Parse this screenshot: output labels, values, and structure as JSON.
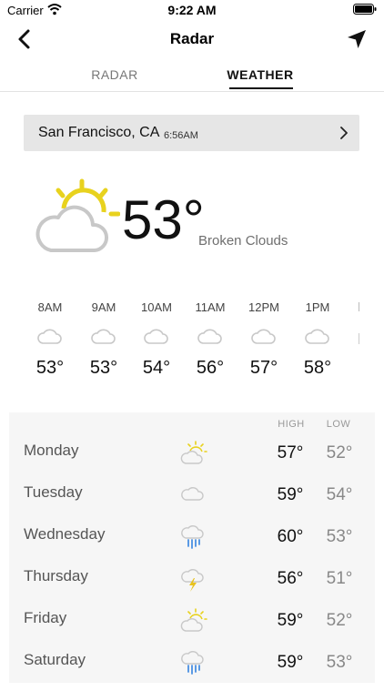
{
  "status": {
    "carrier": "Carrier",
    "time": "9:22 AM"
  },
  "nav": {
    "title": "Radar",
    "back_icon": "chevron-left-icon",
    "location_icon": "location-arrow-icon"
  },
  "tabs": [
    {
      "label": "RADAR",
      "active": false
    },
    {
      "label": "WEATHER",
      "active": true
    }
  ],
  "location": {
    "city": "San Francisco, CA",
    "time": "6:56AM"
  },
  "current": {
    "temp": "53°",
    "description": "Broken Clouds",
    "icon": "partly-cloudy-icon"
  },
  "hourly": [
    {
      "time": "8AM",
      "temp": "53°",
      "icon": "cloud-icon"
    },
    {
      "time": "9AM",
      "temp": "53°",
      "icon": "cloud-icon"
    },
    {
      "time": "10AM",
      "temp": "54°",
      "icon": "cloud-icon"
    },
    {
      "time": "11AM",
      "temp": "56°",
      "icon": "cloud-icon"
    },
    {
      "time": "12PM",
      "temp": "57°",
      "icon": "cloud-icon"
    },
    {
      "time": "1PM",
      "temp": "58°",
      "icon": "cloud-icon"
    }
  ],
  "daily": {
    "high_label": "HIGH",
    "low_label": "LOW",
    "days": [
      {
        "day": "Monday",
        "high": "57°",
        "low": "52°",
        "icon": "partly-cloudy-icon"
      },
      {
        "day": "Tuesday",
        "high": "59°",
        "low": "54°",
        "icon": "cloud-icon"
      },
      {
        "day": "Wednesday",
        "high": "60°",
        "low": "53°",
        "icon": "rain-icon"
      },
      {
        "day": "Thursday",
        "high": "56°",
        "low": "51°",
        "icon": "thunderstorm-icon"
      },
      {
        "day": "Friday",
        "high": "59°",
        "low": "52°",
        "icon": "partly-cloudy-icon"
      },
      {
        "day": "Saturday",
        "high": "59°",
        "low": "53°",
        "icon": "rain-icon"
      }
    ]
  },
  "colors": {
    "sun": "#e8d21e",
    "cloud": "#c8c8c8",
    "rain": "#4a90e2",
    "bolt": "#e8c21e",
    "panel": "#f6f6f6"
  }
}
